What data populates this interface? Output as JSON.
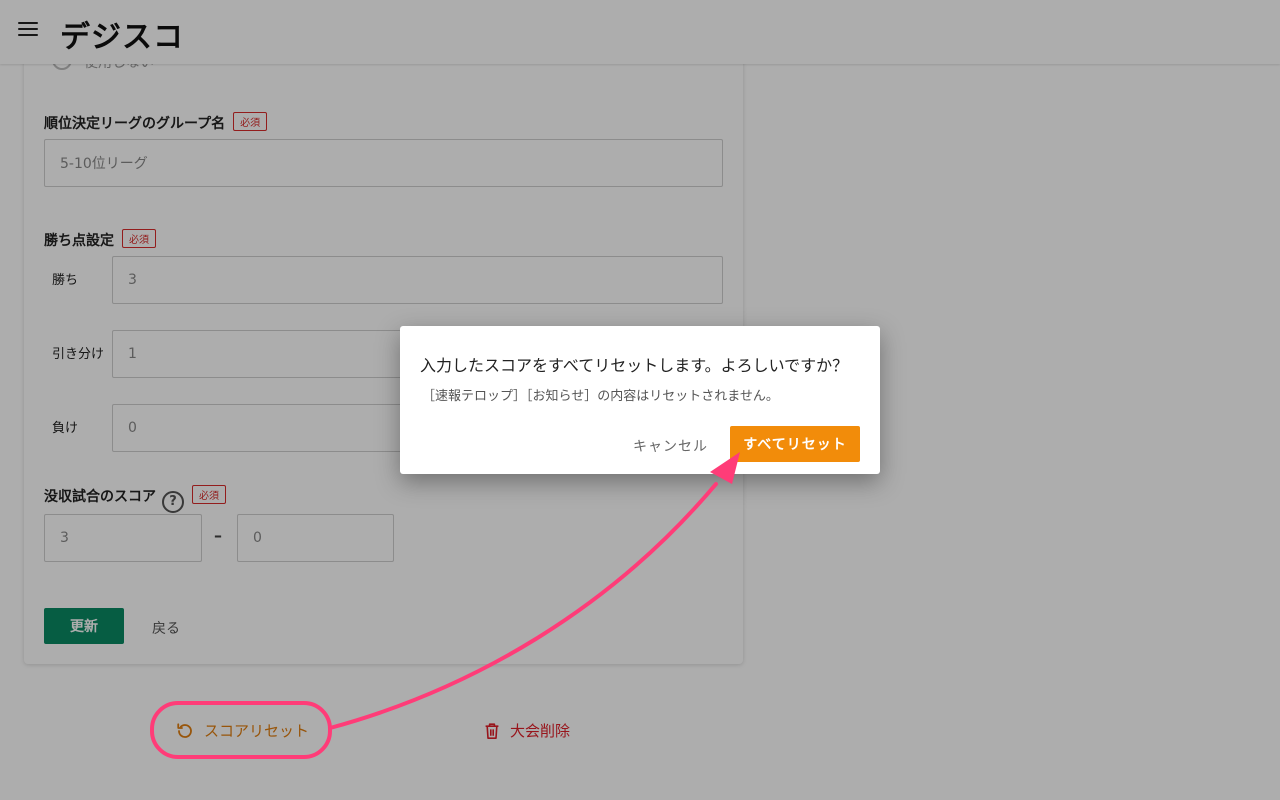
{
  "header": {
    "logo_text": "デジスコ"
  },
  "form": {
    "radio_partial_label": "使用しない",
    "group_name": {
      "label": "順位決定リーグのグループ名",
      "required": "必須",
      "placeholder": "5-10位リーグ"
    },
    "points": {
      "label": "勝ち点設定",
      "required": "必須",
      "win_label": "勝ち",
      "win_value": "3",
      "draw_label": "引き分け",
      "draw_value": "1",
      "loss_label": "負け",
      "loss_value": "0"
    },
    "forfeit": {
      "label": "没収試合のスコア",
      "required": "必須",
      "help": "?",
      "score_a": "3",
      "separator": "–",
      "score_b": "0"
    },
    "update_label": "更新",
    "back_label": "戻る"
  },
  "actions": {
    "reset_label": "スコアリセット",
    "delete_label": "大会削除"
  },
  "dialog": {
    "title": "入力したスコアをすべてリセットします。よろしいですか？",
    "message": "［速報テロップ］［お知らせ］の内容はリセットされません。",
    "cancel_label": "キャンセル",
    "confirm_label": "すべてリセット"
  },
  "colors": {
    "primary_green": "#0a8a63",
    "accent_orange": "#f28c0a",
    "danger_red": "#e0202a",
    "annotation_pink": "#ff3c78"
  }
}
